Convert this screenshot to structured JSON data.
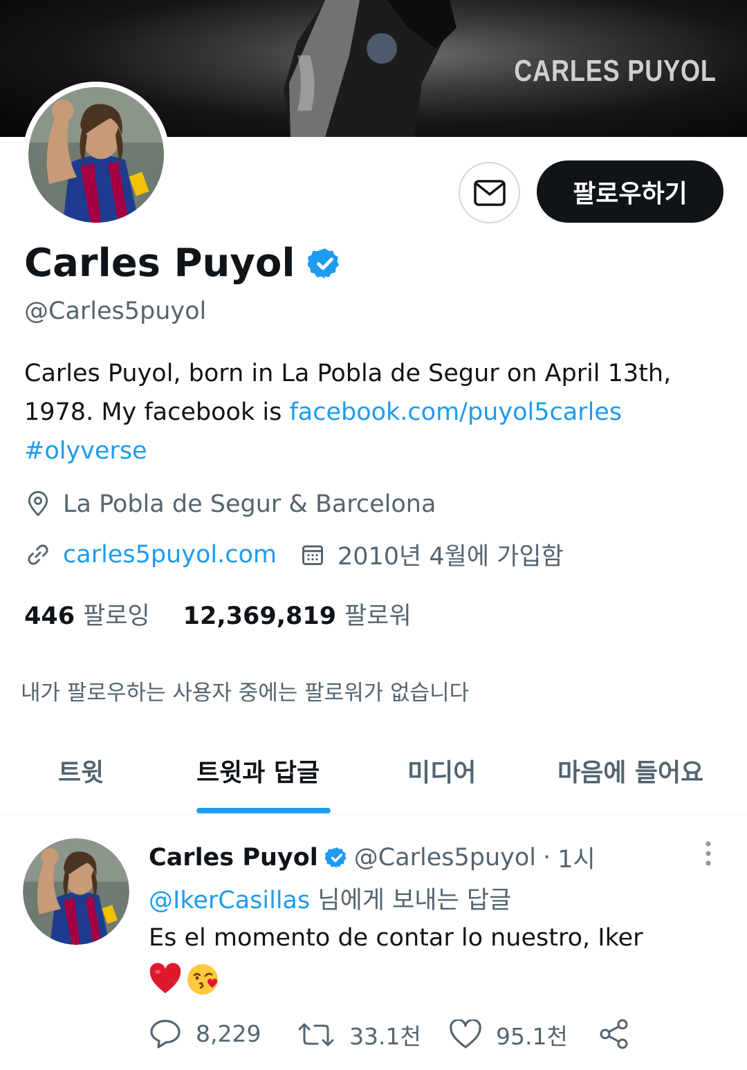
{
  "banner": {
    "title": "CARLES PUYOL"
  },
  "profile": {
    "display_name": "Carles Puyol",
    "handle": "@Carles5puyol",
    "follow_label": "팔로우하기",
    "bio_text_1": "Carles Puyol, born in La Pobla de Segur on April 13th, 1978. My facebook is ",
    "bio_link": "facebook.com/puyol5carles",
    "bio_hashtag": "#olyverse",
    "location": "La Pobla de Segur & Barcelona",
    "website": "carles5puyol.com",
    "joined": "2010년 4월에 가입함",
    "following_count": "446",
    "following_label": "팔로잉",
    "followers_count": "12,369,819",
    "followers_label": "팔로워",
    "no_followers_notice": "내가 팔로우하는 사용자 중에는 팔로워가 없습니다"
  },
  "tabs": [
    {
      "label": "트윗",
      "active": false
    },
    {
      "label": "트윗과 답글",
      "active": true
    },
    {
      "label": "미디어",
      "active": false
    },
    {
      "label": "마음에 들어요",
      "active": false
    }
  ],
  "tweet": {
    "name": "Carles Puyol",
    "handle": "@Carles5puyol",
    "separator": "·",
    "time": "1시",
    "reply_mention": "@IkerCasillas",
    "reply_suffix": " 님에게 보내는 답글",
    "text": "Es el momento de contar lo nuestro, Iker",
    "emojis": [
      "red-heart",
      "face-blowing-a-kiss"
    ],
    "replies": "8,229",
    "retweets": "33.1천",
    "likes": "95.1천"
  },
  "icons": [
    "envelope-icon",
    "verified-badge-icon",
    "location-pin-icon",
    "link-icon",
    "calendar-icon",
    "more-vertical-icon",
    "reply-icon",
    "retweet-icon",
    "like-icon",
    "share-icon"
  ],
  "colors": {
    "accent": "#1d9bf0",
    "text": "#0f1419",
    "muted": "#536471",
    "button_dark": "#0f1419"
  }
}
